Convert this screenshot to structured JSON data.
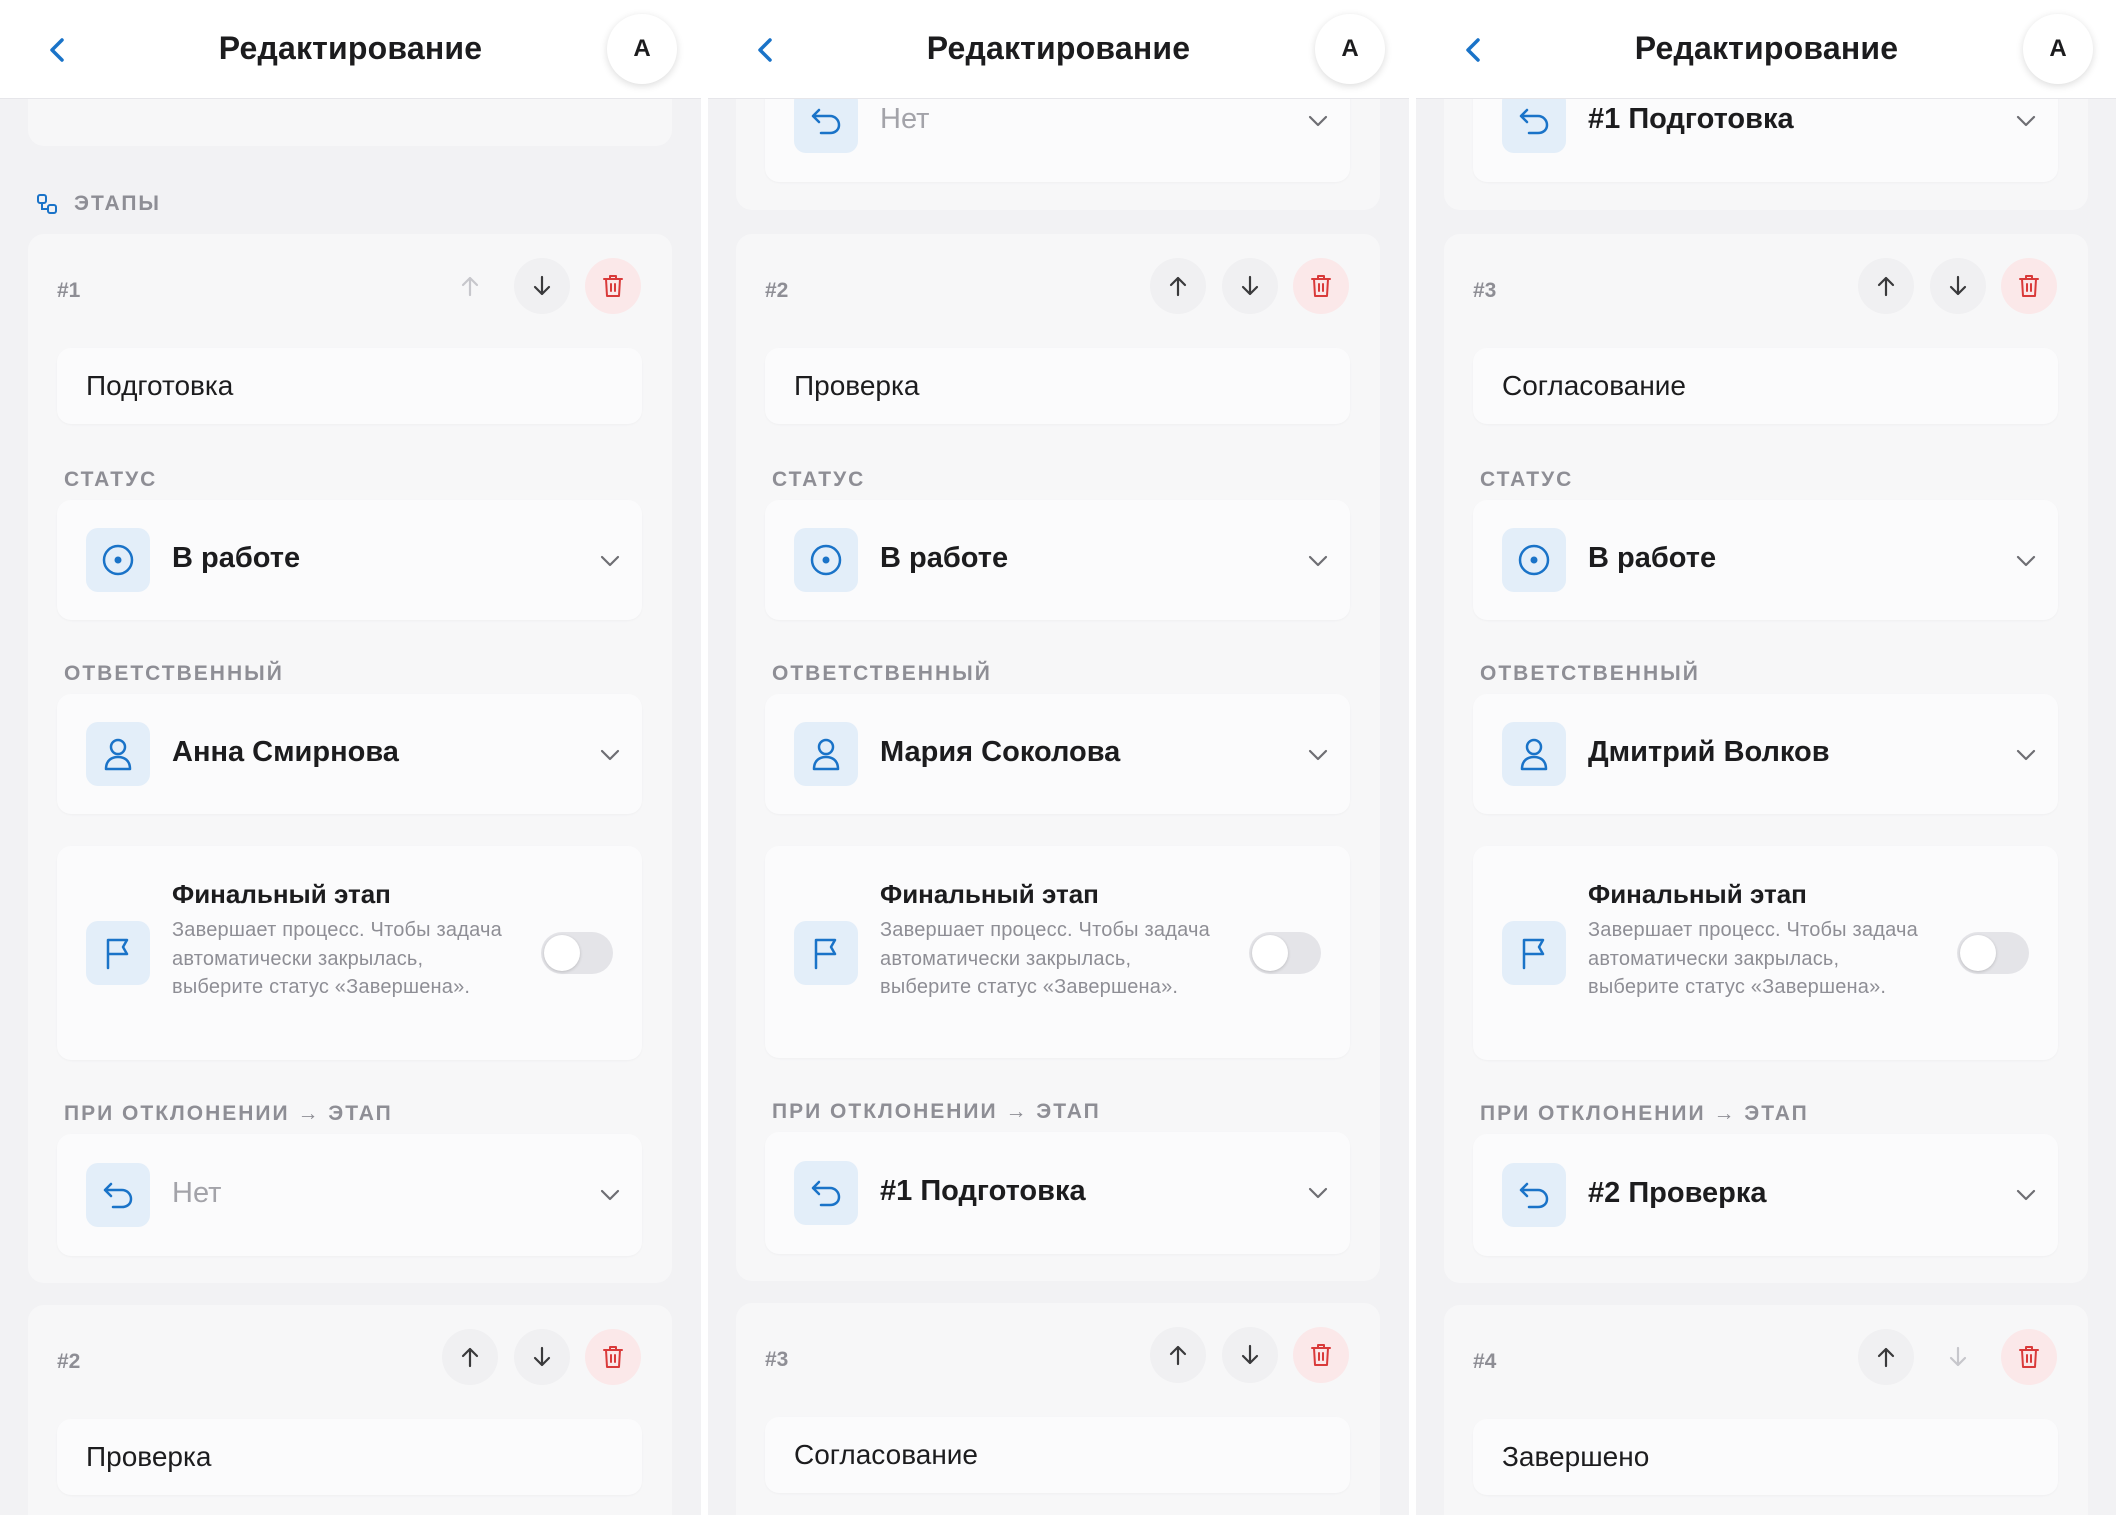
{
  "header": {
    "title": "Редактирование",
    "avatar": "A"
  },
  "stages_label": "ЭТАПЫ",
  "labels": {
    "status": "СТАТУС",
    "assignee": "ОТВЕТСТВЕННЫЙ",
    "final_title": "Финальный этап",
    "final_desc": "Завершает процесс. Чтобы задача автоматически закрылась, выберите статус «Завершена».",
    "reject": "ПРИ ОТКЛОНЕНИИ → ЭТАП"
  },
  "panels": [
    {
      "stage": {
        "num": "#1",
        "name": "Подготовка",
        "status": "В работе",
        "assignee": "Анна Смирнова",
        "final": false,
        "reject": "Нет"
      },
      "next": {
        "num": "#2",
        "name": "Проверка"
      }
    },
    {
      "top_reject": "Нет",
      "stage": {
        "num": "#2",
        "name": "Проверка",
        "status": "В работе",
        "assignee": "Мария Соколова",
        "final": false,
        "reject": "#1 Подготовка"
      },
      "next": {
        "num": "#3",
        "name": "Согласование"
      }
    },
    {
      "top_reject": "#1 Подготовка",
      "stage": {
        "num": "#3",
        "name": "Согласование",
        "status": "В работе",
        "assignee": "Дмитрий Волков",
        "final": false,
        "reject": "#2 Проверка"
      },
      "next": {
        "num": "#4",
        "name": "Завершено"
      }
    }
  ],
  "colors": {
    "accent": "#1a73c8",
    "icon_bg": "#e3eef9",
    "danger": "#d93a3a",
    "danger_bg": "#fbe8e9"
  }
}
